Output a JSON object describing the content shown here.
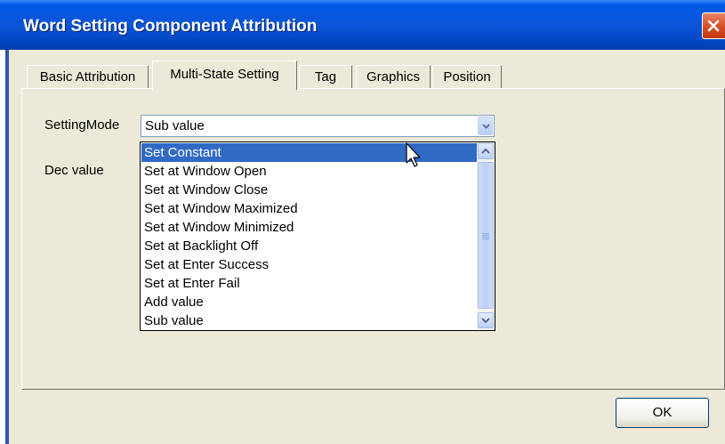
{
  "window": {
    "title": "Word Setting Component Attribution",
    "close_icon": "close-icon",
    "accent_color": "#0058e6"
  },
  "tabs": [
    {
      "label": "Basic Attribution",
      "active": false
    },
    {
      "label": "Multi-State Setting",
      "active": true
    },
    {
      "label": "Tag",
      "active": false
    },
    {
      "label": "Graphics",
      "active": false
    },
    {
      "label": "Position",
      "active": false
    }
  ],
  "form": {
    "setting_mode_label": "SettingMode",
    "setting_mode_value": "Sub value",
    "dec_value_label": "Dec value"
  },
  "dropdown": {
    "options": [
      "Set Constant",
      "Set at Window Open",
      "Set at Window Close",
      "Set at Window Maximized",
      "Set at Window Minimized",
      "Set at Backlight Off",
      "Set at Enter Success",
      "Set at Enter Fail",
      "Add value",
      "Sub value"
    ],
    "highlighted": "Set Constant",
    "highlight_color": "#316ac5"
  },
  "buttons": {
    "ok_label": "OK"
  }
}
